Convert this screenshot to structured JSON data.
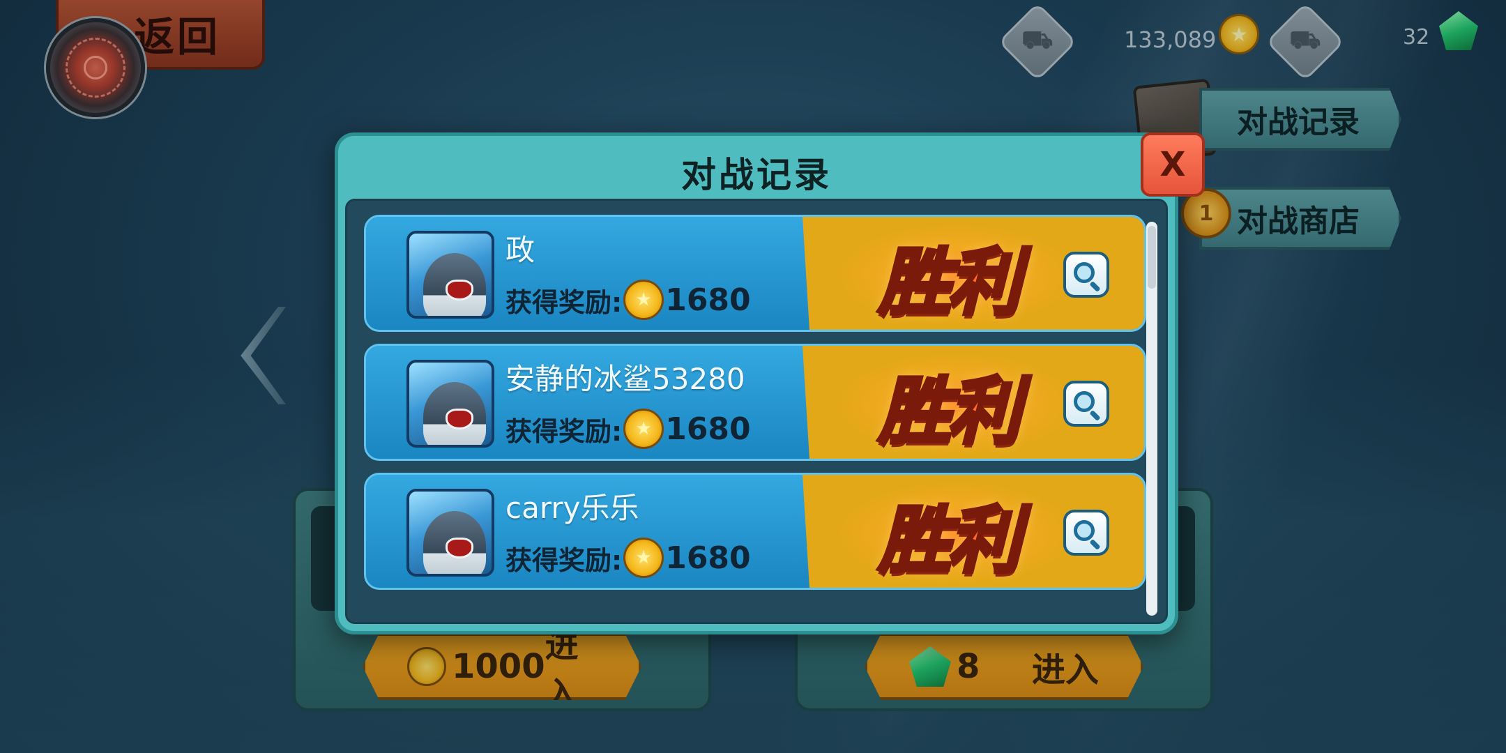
{
  "top_left": {
    "back_label": "返回"
  },
  "currency": {
    "coins": "133,089",
    "gems": "32"
  },
  "side_menu": {
    "battle_record": "对战记录",
    "battle_shop": "对战商店"
  },
  "bg_cards": [
    {
      "cost": "1000",
      "enter": "进入",
      "currency": "coin"
    },
    {
      "cost": "8",
      "enter": "进入",
      "currency": "gem"
    }
  ],
  "modal": {
    "title": "对战记录",
    "close_label": "X",
    "records": [
      {
        "name": "政",
        "reward_label": "获得奖励:",
        "reward_value": "1680",
        "result": "胜利"
      },
      {
        "name": "安静的冰鲨53280",
        "reward_label": "获得奖励:",
        "reward_value": "1680",
        "result": "胜利"
      },
      {
        "name": "carry乐乐",
        "reward_label": "获得奖励:",
        "reward_value": "1680",
        "result": "胜利"
      }
    ]
  },
  "icons": {
    "cart": "shopping-cart-icon",
    "coin": "gold-coin-icon",
    "gem": "green-gem-icon",
    "zoom": "magnifier-icon",
    "radar": "radar-icon"
  },
  "colors": {
    "modal_bg": "#4fbcc0",
    "row_blue": "#1e8fcc",
    "row_gold": "#e3a817",
    "close_red": "#e5553b",
    "result_orange": "#ff6a2a"
  }
}
